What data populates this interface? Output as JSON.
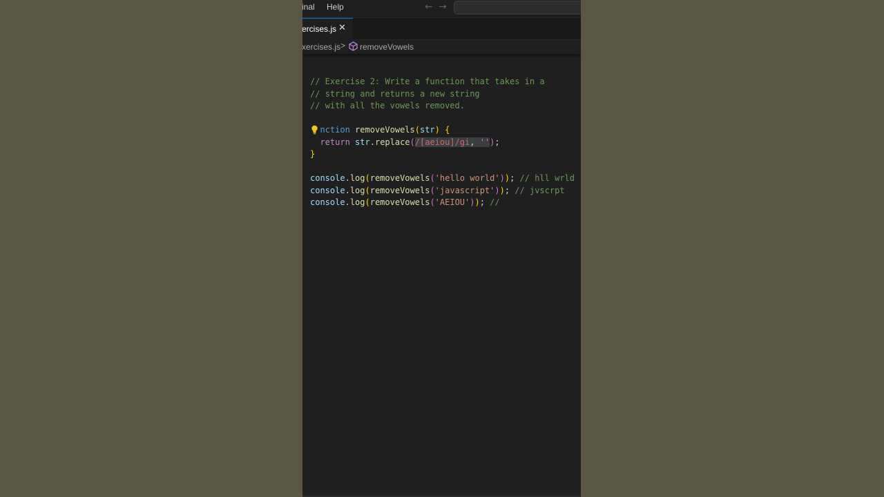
{
  "menubar": {
    "items": [
      "inal",
      "Help"
    ],
    "back_arrow": "←",
    "forward_arrow": "→"
  },
  "tab": {
    "label": "ercises.js",
    "close": "✕"
  },
  "breadcrumb": {
    "file": "xercises.js",
    "separator": ">",
    "symbol_icon": "cube-method-icon",
    "symbol": "removeVowels"
  },
  "code": {
    "comment_1": "// Exercise 2: Write a function that takes in a",
    "comment_2": "// string and returns a new string",
    "comment_3": "// with all the vowels removed.",
    "fn_keyword": "nction",
    "fn_name": "removeVowels",
    "param": "str",
    "return_keyword": "return",
    "replace_obj": "str",
    "replace_method": "replace",
    "regex": "/[aeiou]/gi",
    "empty_string": "''",
    "call_1_arg": "'hello world'",
    "call_1_comment": "// hll wrld",
    "call_2_arg": "'javascript'",
    "call_2_comment": "// jvscrpt",
    "call_3_arg": "'AEIOU'",
    "call_3_comment": "//",
    "console": "console",
    "log": "log",
    "call_fn": "removeVowels"
  },
  "colors": {
    "comment": "#6a9955",
    "keyword": "#569cd6",
    "control": "#c586c0",
    "function": "#dcdcaa",
    "variable": "#9cdcfe",
    "string": "#ce9178",
    "regex": "#d16969",
    "brace": "#ffd700",
    "bulb": "#f5c518",
    "accent": "#0078d4"
  }
}
